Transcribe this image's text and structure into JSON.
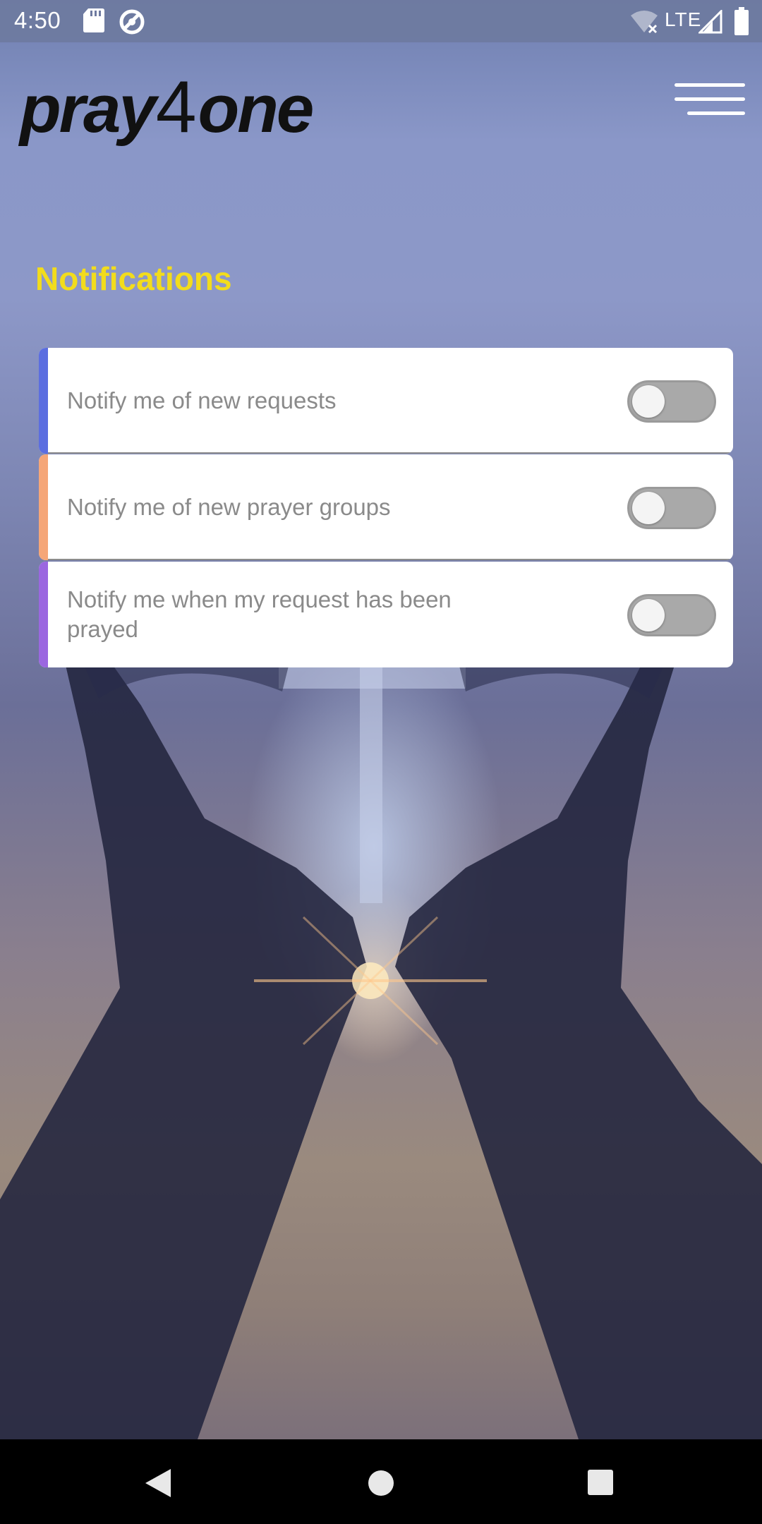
{
  "status_bar": {
    "time": "4:50",
    "network_label": "LTE",
    "icons": [
      "sd-card-icon",
      "data-saver-icon",
      "wifi-off-icon",
      "signal-icon",
      "battery-icon"
    ]
  },
  "header": {
    "logo_part1": "pray",
    "logo_part2": "4",
    "logo_part3": "one",
    "menu_icon": "hamburger-menu-icon"
  },
  "page": {
    "title": "Notifications"
  },
  "settings": [
    {
      "label": "Notify me of new requests",
      "accent": "#5b6ee0",
      "enabled": false
    },
    {
      "label": "Notify me of new prayer groups",
      "accent": "#f5a678",
      "enabled": false
    },
    {
      "label": "Notify me when my request has been prayed",
      "accent": "#9b67e0",
      "enabled": false
    }
  ],
  "colors": {
    "title": "#f2dc1c",
    "card_bg": "#ffffff",
    "toggle_off": "#a9a9a9"
  },
  "nav_bar": {
    "icons": [
      "back-icon",
      "home-icon",
      "recents-icon"
    ]
  }
}
